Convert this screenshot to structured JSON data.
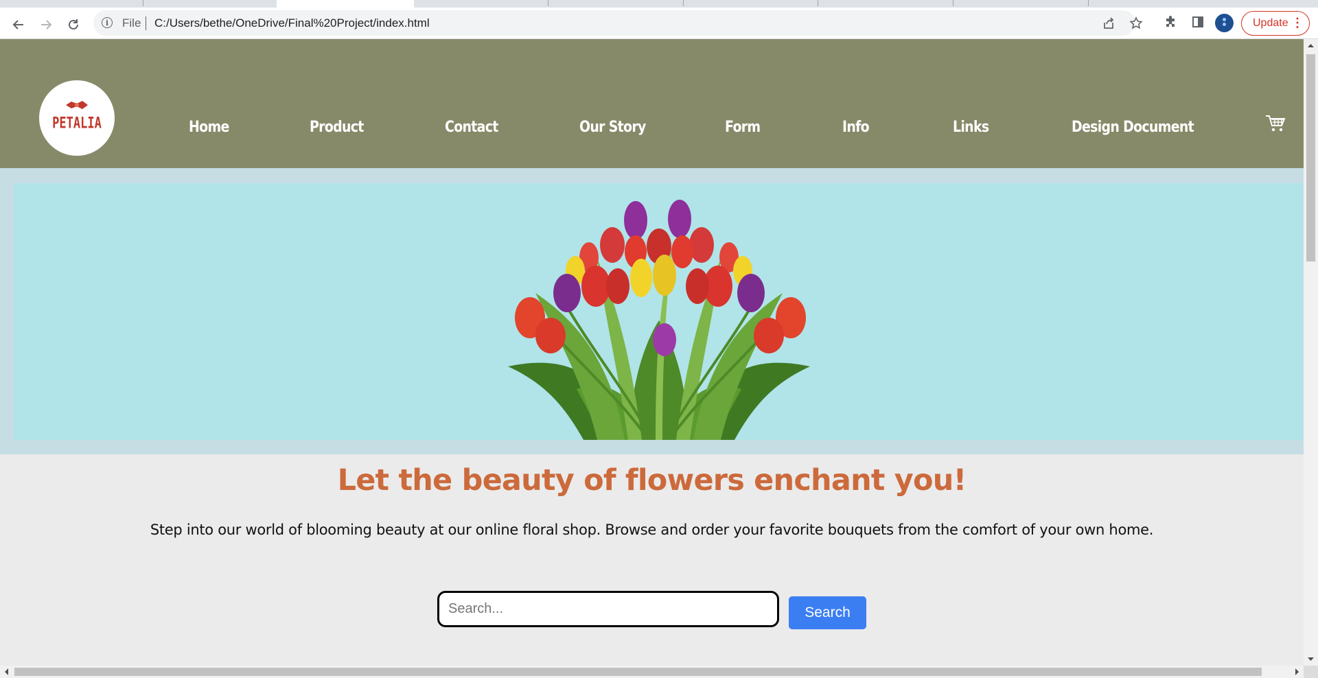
{
  "browser": {
    "file_label": "File",
    "url": "C:/Users/bethe/OneDrive/Final%20Project/index.html",
    "update_label": "Update",
    "icons": [
      "back-icon",
      "forward-icon",
      "reload-icon",
      "info-icon",
      "share-icon",
      "star-icon",
      "extensions-icon",
      "side-panel-icon",
      "profile-avatar",
      "menu-icon"
    ]
  },
  "site": {
    "logo_text": "PETALIA",
    "nav": [
      {
        "label": "Home"
      },
      {
        "label": "Product"
      },
      {
        "label": "Contact"
      },
      {
        "label": "Our Story"
      },
      {
        "label": "Form"
      },
      {
        "label": "Info"
      },
      {
        "label": "Links"
      },
      {
        "label": "Design Document"
      }
    ],
    "cart_icon": "shopping-cart-icon",
    "colors": {
      "header": "#878a69",
      "hero": "#b0e4e9",
      "headline": "#cc6a3c",
      "search_button": "#3a7ef2"
    }
  },
  "main": {
    "headline": "Let the beauty of flowers enchant you!",
    "tagline": "Step into our world of blooming beauty at our online floral shop. Browse and order your favorite bouquets from the comfort of your own home.",
    "search_placeholder": "Search...",
    "search_button": "Search"
  }
}
